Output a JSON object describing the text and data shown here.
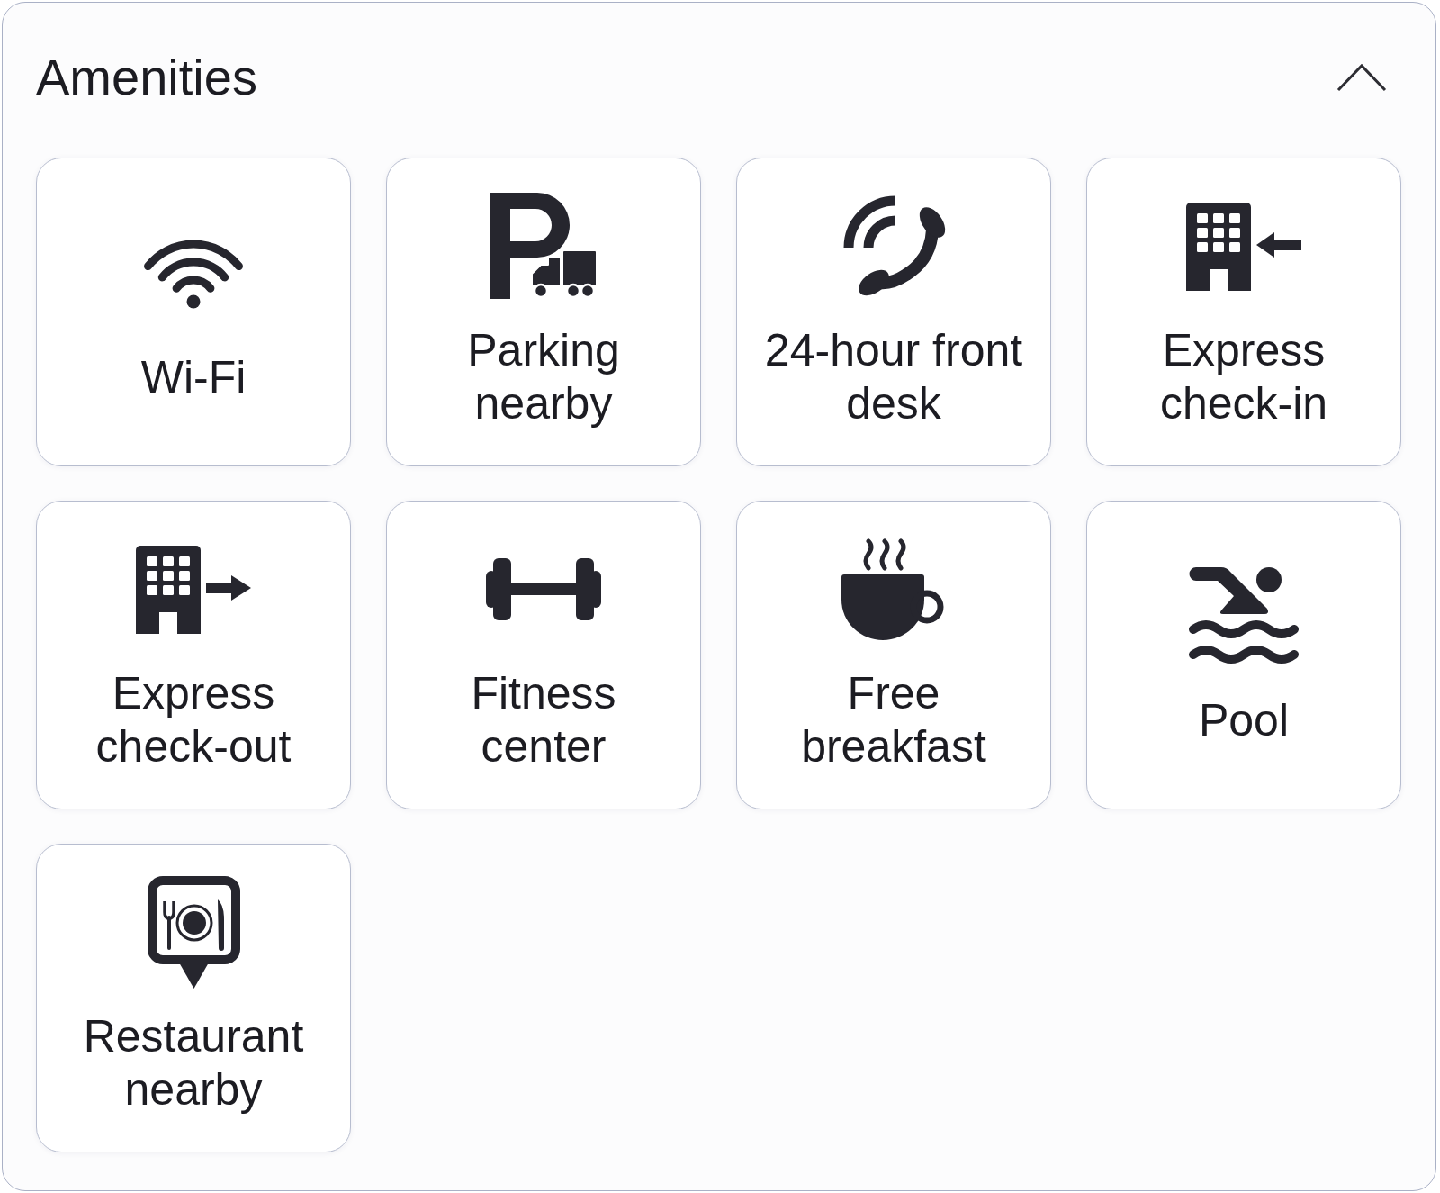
{
  "panel": {
    "title": "Amenities",
    "expanded": true
  },
  "amenities": [
    {
      "kind": "wifi",
      "label": "Wi-Fi"
    },
    {
      "kind": "parking",
      "label": "Parking nearby"
    },
    {
      "kind": "phone",
      "label": "24-hour front desk"
    },
    {
      "kind": "checkin",
      "label": "Express check-in"
    },
    {
      "kind": "checkout",
      "label": "Express check-out"
    },
    {
      "kind": "fitness",
      "label": "Fitness center"
    },
    {
      "kind": "breakfast",
      "label": "Free breakfast"
    },
    {
      "kind": "pool",
      "label": "Pool"
    },
    {
      "kind": "restaurant",
      "label": "Restaurant nearby"
    }
  ]
}
